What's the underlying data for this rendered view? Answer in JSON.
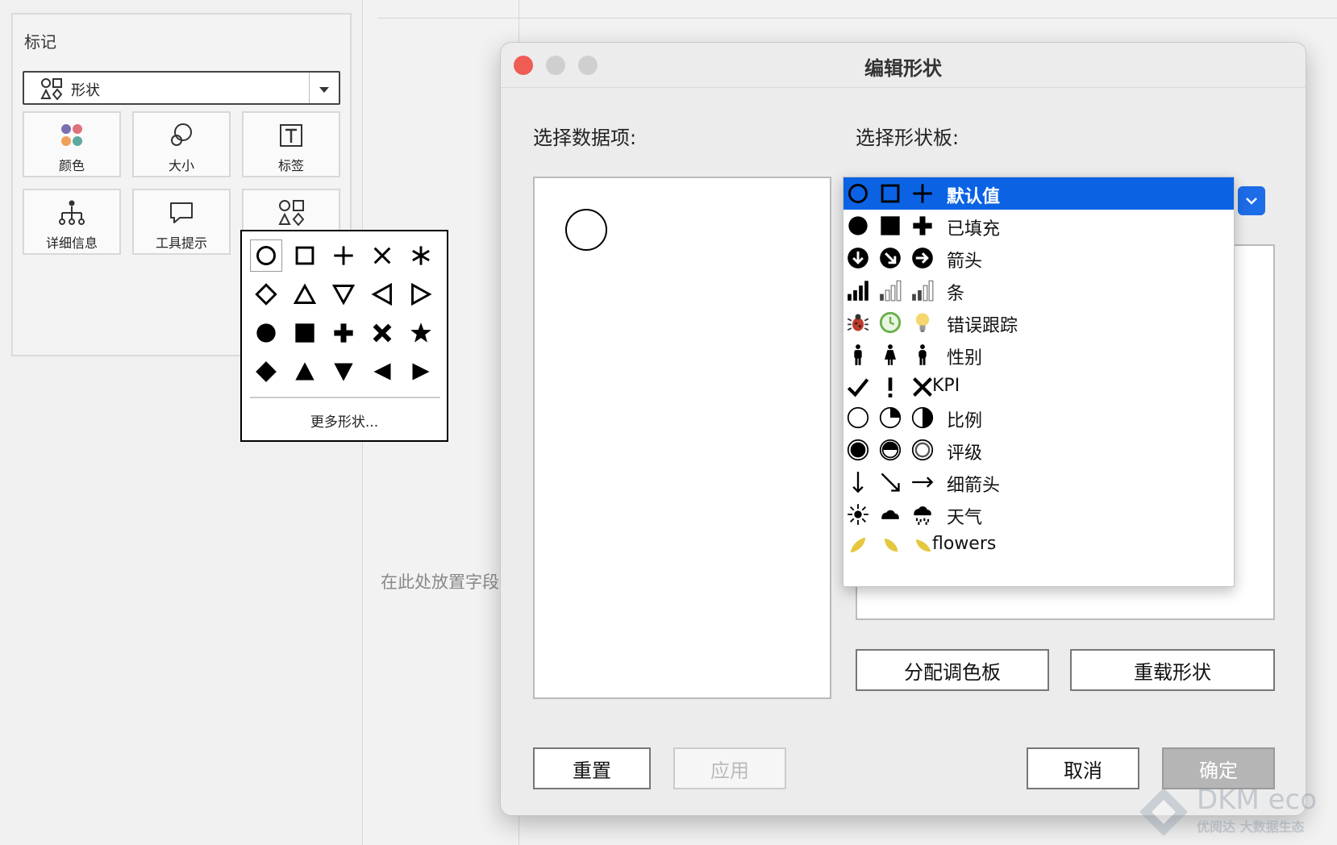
{
  "marks_panel": {
    "title": "标记",
    "mark_type": "形状",
    "buttons": [
      {
        "label": "颜色",
        "icon": "color-dots-icon"
      },
      {
        "label": "大小",
        "icon": "size-circles-icon"
      },
      {
        "label": "标签",
        "icon": "label-t-icon"
      },
      {
        "label": "详细信息",
        "icon": "detail-tree-icon"
      },
      {
        "label": "工具提示",
        "icon": "tooltip-bubble-icon"
      },
      {
        "label": "",
        "icon": "shapes-icon"
      }
    ]
  },
  "shape_popup": {
    "shapes": [
      "open-circle",
      "open-square",
      "plus",
      "x",
      "asterisk",
      "open-diamond",
      "open-triangle-up",
      "open-triangle-down",
      "open-triangle-left",
      "open-triangle-right",
      "filled-circle",
      "filled-square",
      "filled-plus",
      "filled-x",
      "filled-star",
      "filled-diamond",
      "filled-triangle-up",
      "filled-triangle-down",
      "filled-triangle-left",
      "filled-triangle-right"
    ],
    "more_label": "更多形状..."
  },
  "canvas": {
    "drop_hint": "在此处放置字段"
  },
  "dialog": {
    "title": "编辑形状",
    "select_items_label": "选择数据项:",
    "select_palette_label": "选择形状板:",
    "assign_palette_button": "分配调色板",
    "reload_shapes_button": "重载形状",
    "reset_button": "重置",
    "apply_button": "应用",
    "cancel_button": "取消",
    "ok_button": "确定"
  },
  "palette_list": {
    "selected_index": 0,
    "items": [
      {
        "name": "默认值",
        "icons": [
          "open-circle",
          "open-square",
          "plus"
        ]
      },
      {
        "name": "已填充",
        "icons": [
          "filled-circle",
          "filled-square",
          "filled-plus"
        ]
      },
      {
        "name": "箭头",
        "icons": [
          "arrow-down-circle",
          "arrow-downright-circle",
          "arrow-right-circle"
        ]
      },
      {
        "name": "条",
        "icons": [
          "bars-full",
          "bars-low",
          "bars-mid"
        ]
      },
      {
        "name": "错误跟踪",
        "icons": [
          "bug",
          "clock",
          "lightbulb"
        ]
      },
      {
        "name": "性别",
        "icons": [
          "man",
          "woman",
          "man-alt"
        ]
      },
      {
        "name": "KPI",
        "icons": [
          "check",
          "exclamation",
          "cross"
        ]
      },
      {
        "name": "比例",
        "icons": [
          "circle-empty",
          "circle-quarter",
          "circle-half"
        ]
      },
      {
        "name": "评级",
        "icons": [
          "rating-full",
          "rating-half",
          "rating-ring"
        ]
      },
      {
        "name": "细箭头",
        "icons": [
          "thin-arrow-down",
          "thin-arrow-downright",
          "thin-arrow-right"
        ]
      },
      {
        "name": "天气",
        "icons": [
          "sun",
          "cloud",
          "rain-cloud"
        ]
      },
      {
        "name": "flowers",
        "icons": [
          "petal-1",
          "petal-2",
          "petal-3"
        ]
      }
    ]
  },
  "watermark": {
    "brand": "DKM eco",
    "tagline": "优阅达 大数据生态"
  },
  "colors": {
    "selection_blue": "#0b63e4",
    "dropdown_blue": "#1d6ce8",
    "close_red": "#ee5c54"
  }
}
